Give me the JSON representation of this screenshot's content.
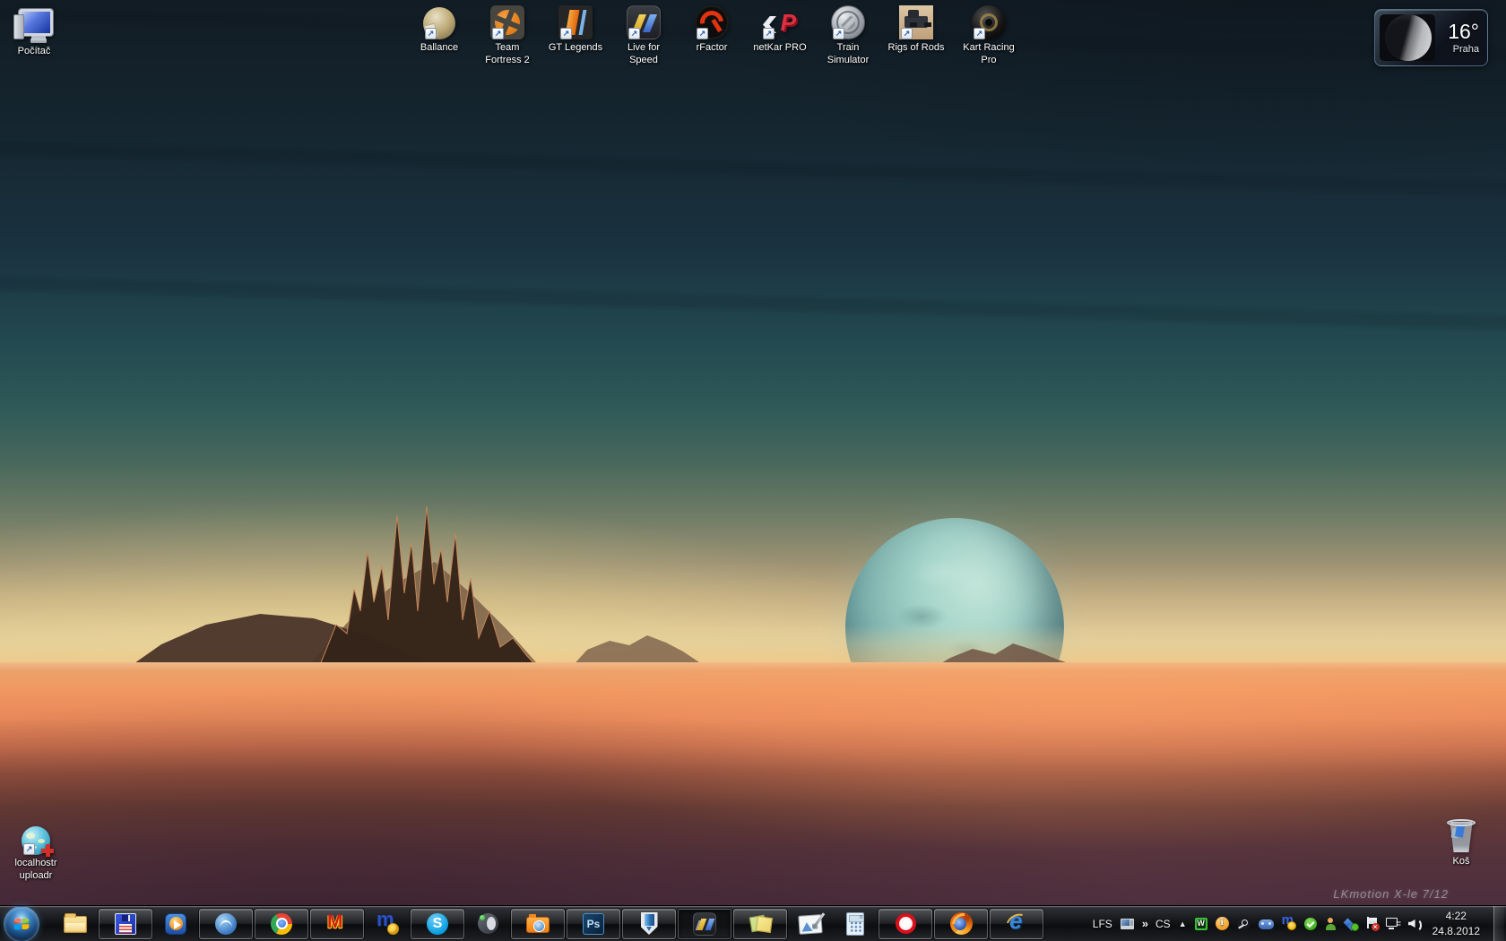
{
  "desktop": {
    "computer": {
      "label": "Počítač"
    },
    "shortcuts": [
      {
        "label": "Ballance"
      },
      {
        "label": "Team\nFortress 2"
      },
      {
        "label": "GT Legends"
      },
      {
        "label": "Live for\nSpeed"
      },
      {
        "label": "rFactor"
      },
      {
        "label": "netKar PRO"
      },
      {
        "label": "Train\nSimulator"
      },
      {
        "label": "Rigs of Rods"
      },
      {
        "label": "Kart Racing\nPro"
      }
    ],
    "uploader": {
      "label": "localhostr\nuploadr"
    },
    "recycle_bin": {
      "label": "Koš"
    },
    "wallpaper_signature": "LKmotion X-le 7/12"
  },
  "weather_gadget": {
    "temperature": "16°",
    "city": "Praha"
  },
  "taskbar": {
    "tray": {
      "lfs_label": "LFS",
      "overflow_chevron": "»",
      "language": "CS",
      "expand_arrow": "▲",
      "clock": {
        "time": "4:22",
        "date": "24.8.2012"
      }
    }
  },
  "colors": {
    "sky_top": "#121c24",
    "horizon_glow": "#ecd49c",
    "desert": "#f09760",
    "shadow": "#503140",
    "planet": "#a5d6cc",
    "taskbar": "#17181b"
  }
}
